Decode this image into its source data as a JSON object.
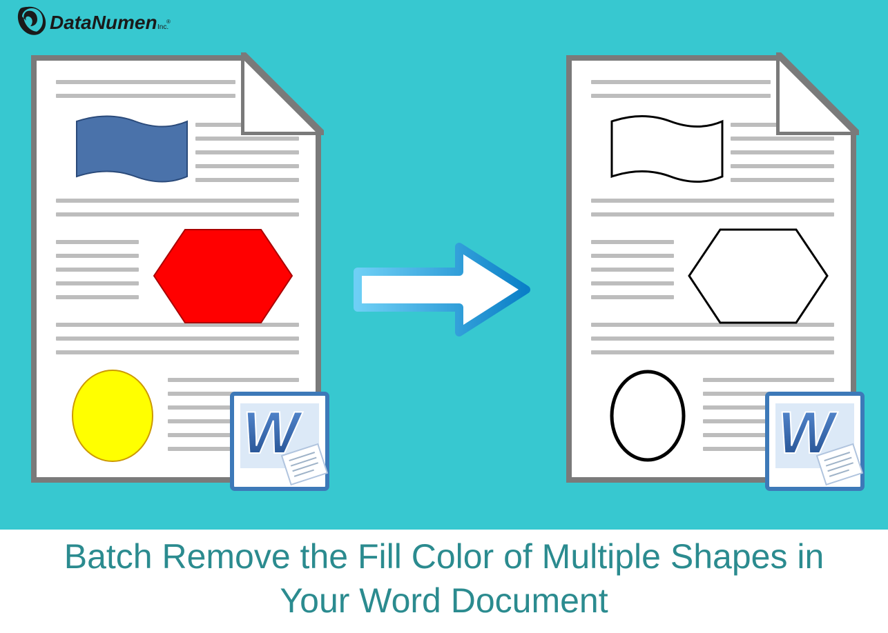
{
  "brand": {
    "name": "DataNumen",
    "suffix": "Inc."
  },
  "headline": "Batch Remove the Fill Color of Multiple Shapes in Your Word Document",
  "colors": {
    "teal_bg": "#37c8d0",
    "page_border": "#7a7a7a",
    "text_line": "#bdbdbd",
    "flag_fill": "#4a72aa",
    "hex_fill": "#ff0000",
    "ellipse_fill": "#ffff00",
    "arrow_stroke": "#2aa7e0",
    "headline_color": "#2b8b8f",
    "word_blue": "#2a5fb0",
    "word_badge_border": "#3d79b8"
  },
  "documents": {
    "left": {
      "shapes_filled": true
    },
    "right": {
      "shapes_filled": false
    }
  },
  "icons": {
    "word": "W",
    "arrow": "right-arrow"
  }
}
